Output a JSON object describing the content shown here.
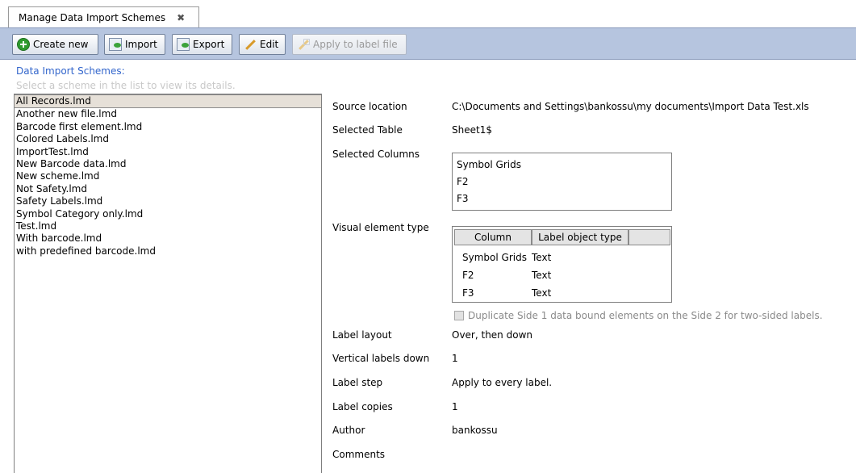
{
  "tab": {
    "title": "Manage Data Import Schemes",
    "close": "✖"
  },
  "toolbar": {
    "create_new": "Create new",
    "import": "Import",
    "export": "Export",
    "edit": "Edit",
    "apply": "Apply to label file"
  },
  "list": {
    "title": "Data Import Schemes:",
    "hint": "Select a scheme in the list to view its details.",
    "items": [
      "All Records.lmd",
      "Another new file.lmd",
      "Barcode first element.lmd",
      "Colored Labels.lmd",
      "ImportTest.lmd",
      "New Barcode data.lmd",
      "New scheme.lmd",
      "Not Safety.lmd",
      "Safety Labels.lmd",
      "Symbol Category only.lmd",
      "Test.lmd",
      "With barcode.lmd",
      "with predefined barcode.lmd"
    ],
    "selected_index": 0
  },
  "details": {
    "source_location_label": "Source location",
    "source_location": "C:\\Documents and Settings\\bankossu\\my documents\\Import Data Test.xls",
    "selected_table_label": "Selected Table",
    "selected_table": "Sheet1$",
    "selected_columns_label": "Selected Columns",
    "selected_columns": [
      "Symbol Grids",
      "F2",
      "F3"
    ],
    "visual_type_label": "Visual element type",
    "visual_headers": [
      "Column",
      "Label object type"
    ],
    "visual_rows": [
      {
        "column": "Symbol Grids",
        "type": "Text"
      },
      {
        "column": "F2",
        "type": "Text"
      },
      {
        "column": "F3",
        "type": "Text"
      }
    ],
    "duplicate_text": "Duplicate Side 1 data bound elements on the Side 2 for two-sided labels.",
    "label_layout_label": "Label layout",
    "label_layout": "Over, then down",
    "vertical_down_label": "Vertical labels down",
    "vertical_down": "1",
    "label_step_label": "Label step",
    "label_step": "Apply to every label.",
    "label_copies_label": "Label copies",
    "label_copies": "1",
    "author_label": "Author",
    "author": "bankossu",
    "comments_label": "Comments",
    "comments": ""
  },
  "colors": {
    "toolbar_bg": "#b6c5df",
    "title_blue": "#3366cc",
    "selected_row": "#e6e0d8"
  },
  "icons": {
    "create_new": "plus-circle-icon",
    "import": "import-icon",
    "export": "export-icon",
    "edit": "pencil-icon",
    "apply": "apply-label-icon",
    "tab_close": "close-icon"
  }
}
